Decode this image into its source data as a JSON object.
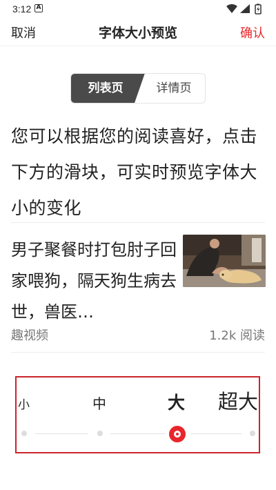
{
  "status_bar": {
    "time": "3:12",
    "notification_icon": "A"
  },
  "nav": {
    "cancel": "取消",
    "title": "字体大小预览",
    "confirm": "确认"
  },
  "tabs": [
    {
      "label": "列表页",
      "active": true
    },
    {
      "label": "详情页",
      "active": false
    }
  ],
  "intro_text": "您可以根据您的阅读喜好，点击下方的滑块，可实时预览字体大小的变化",
  "news": {
    "title": "男子聚餐时打包肘子回家喂狗，隔天狗生病去世，兽医…",
    "source": "趣视频",
    "reads": "1.2k 阅读",
    "image_icon": "man-and-dog-photo"
  },
  "font_size": {
    "options": [
      "小",
      "中",
      "大",
      "超大"
    ],
    "selected": "大",
    "selected_index": 2
  },
  "colors": {
    "accent": "#e8262b",
    "active_tab": "#4a4a4a",
    "highlight_box": "#cc2229"
  }
}
